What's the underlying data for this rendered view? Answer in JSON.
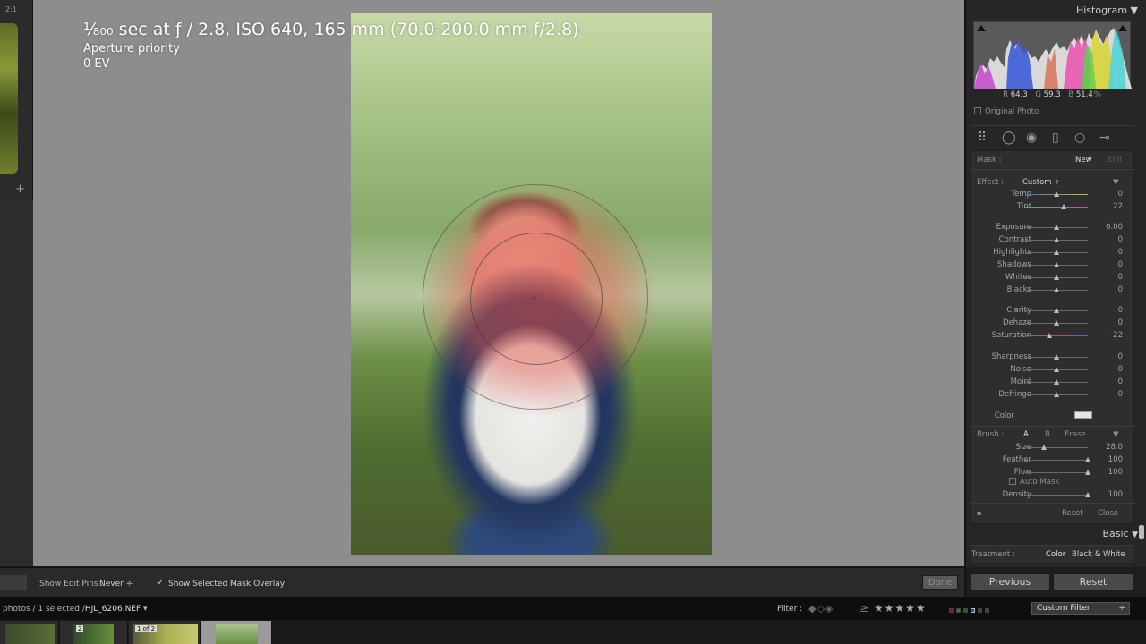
{
  "left_panel": {
    "zoom_label": "2:1",
    "add_icon": "plus-icon"
  },
  "photo_info": {
    "exposure_line": "¹⁄₈₀₀ sec at ƒ / 2.8, ISO 640, 165 mm (70.0-200.0 mm f/2.8)",
    "mode": "Aperture priority",
    "ev": "0 EV"
  },
  "toolbar": {
    "show_edit_pins_label": "Show Edit Pins :",
    "show_edit_pins_value": "Never",
    "overlay_checked": "✓",
    "overlay_label": "Show Selected Mask Overlay",
    "done_label": "Done"
  },
  "histogram": {
    "title": "Histogram",
    "r_label": "R",
    "r_value": "64.3",
    "g_label": "G",
    "g_value": "59.3",
    "b_label": "B",
    "b_value": "51.4",
    "percent": "%",
    "original_photo_label": "Original Photo"
  },
  "mask": {
    "label": "Mask :",
    "new_label": "New",
    "edit_label": "Edit",
    "effect_label": "Effect :",
    "effect_value": "Custom",
    "sliders_group1": [
      {
        "label": "Temp",
        "value": "0",
        "pos": 0.5
      },
      {
        "label": "Tint",
        "value": "22",
        "pos": 0.61
      }
    ],
    "sliders_group2": [
      {
        "label": "Exposure",
        "value": "0.00",
        "pos": 0.5
      },
      {
        "label": "Contrast",
        "value": "0",
        "pos": 0.5
      },
      {
        "label": "Highlights",
        "value": "0",
        "pos": 0.5
      },
      {
        "label": "Shadows",
        "value": "0",
        "pos": 0.5
      },
      {
        "label": "Whites",
        "value": "0",
        "pos": 0.5
      },
      {
        "label": "Blacks",
        "value": "0",
        "pos": 0.5
      }
    ],
    "sliders_group3": [
      {
        "label": "Clarity",
        "value": "0",
        "pos": 0.5
      },
      {
        "label": "Dehaze",
        "value": "0",
        "pos": 0.5
      },
      {
        "label": "Saturation",
        "value": "– 22",
        "pos": 0.39
      }
    ],
    "sliders_group4": [
      {
        "label": "Sharpness",
        "value": "0",
        "pos": 0.5
      },
      {
        "label": "Noise",
        "value": "0",
        "pos": 0.5
      },
      {
        "label": "Moiré",
        "value": "0",
        "pos": 0.5
      },
      {
        "label": "Defringe",
        "value": "0",
        "pos": 0.5
      }
    ],
    "color_label": "Color",
    "brush_label": "Brush :",
    "brush_a": "A",
    "brush_b": "B",
    "brush_erase": "Erase",
    "brush_sliders": [
      {
        "label": "Size",
        "value": "28.0",
        "pos": 0.3
      },
      {
        "label": "Feather",
        "value": "100",
        "pos": 1.0
      },
      {
        "label": "Flow",
        "value": "100",
        "pos": 1.0
      }
    ],
    "auto_mask_label": "Auto Mask",
    "density": {
      "label": "Density",
      "value": "100",
      "pos": 1.0
    },
    "reset_label": "Reset",
    "close_label": "Close"
  },
  "basic": {
    "title": "Basic",
    "treatment_label": "Treatment :",
    "color_option": "Color",
    "bw_option": "Black & White"
  },
  "nav_buttons": {
    "previous": "Previous",
    "reset": "Reset"
  },
  "filmbar": {
    "path_prefix": "photos / 1 selected /",
    "filename": "HJL_6206.NEF",
    "filter_label": "Filter :",
    "ge": "≥",
    "filter_select": "Custom Filter"
  },
  "filmstrip": {
    "badge_2": "2",
    "badge_1of2": "1 of 2"
  },
  "colors": {
    "canvas_bg": "#8d8d8d",
    "panel_bg": "#262626",
    "mask_overlay": "#eb5046"
  }
}
